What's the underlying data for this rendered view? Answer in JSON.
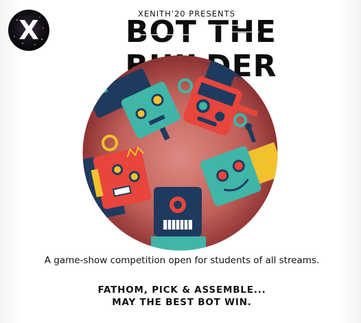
{
  "header": {
    "logo_letter": "X",
    "presents": "XENITH'20 PRESENTS",
    "title": "BOT THE BUILDER"
  },
  "illustration": {
    "description_icon": "robots-circle-illustration",
    "colors": {
      "circle_center": "#d67a73",
      "circle_edge": "#9b3b3b",
      "teal": "#3fb6a8",
      "red": "#e8453c",
      "navy": "#1f3a5f",
      "yellow": "#f2c12e"
    }
  },
  "body": {
    "description": "A game-show competition open for students of all streams.",
    "tagline_line1": "FATHOM, PICK & ASSEMBLE...",
    "tagline_line2": "MAY THE BEST BOT WIN."
  }
}
